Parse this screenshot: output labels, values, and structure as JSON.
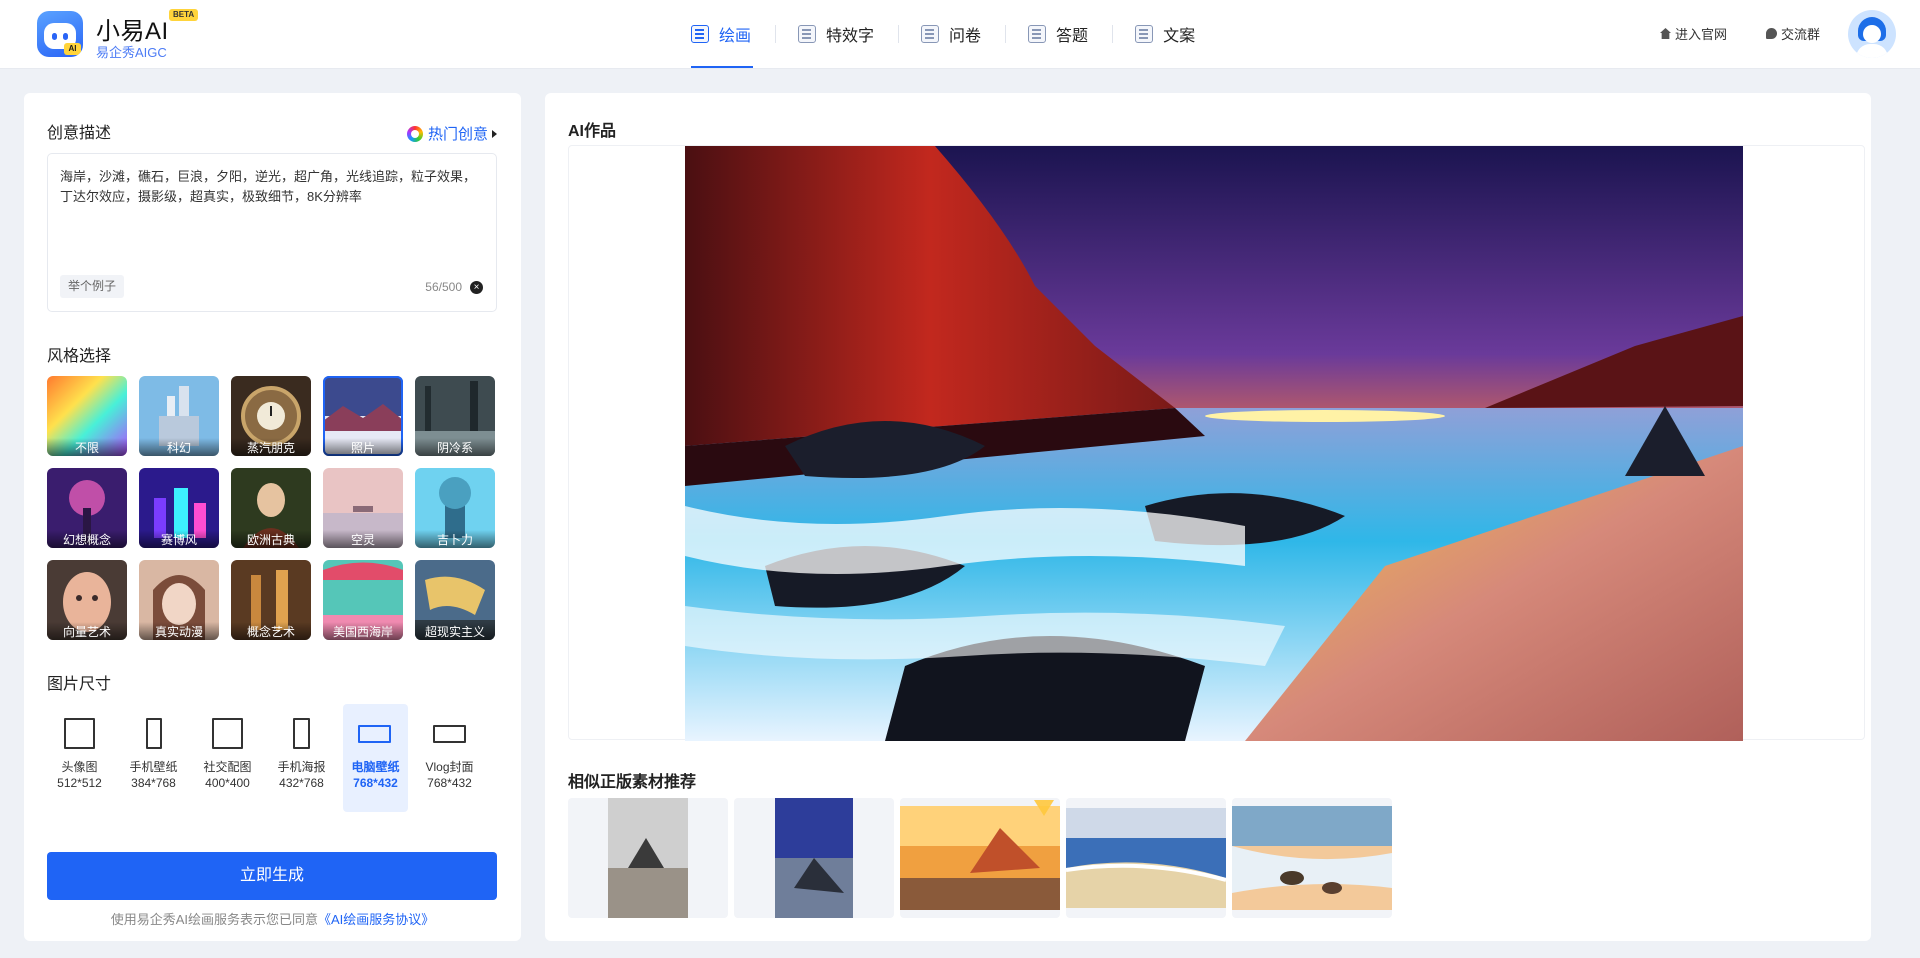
{
  "header": {
    "brand_name": "小易AI",
    "beta": "BETA",
    "brand_sub": "易企秀AIGC",
    "logo_tag": "AI",
    "nav": [
      {
        "label": "绘画",
        "icon": "paint-icon",
        "active": true
      },
      {
        "label": "特效字",
        "icon": "effect-text-icon",
        "active": false
      },
      {
        "label": "问卷",
        "icon": "survey-icon",
        "active": false
      },
      {
        "label": "答题",
        "icon": "quiz-icon",
        "active": false
      },
      {
        "label": "文案",
        "icon": "copywriting-icon",
        "active": false
      }
    ],
    "official_site": "进入官网",
    "community": "交流群"
  },
  "left": {
    "prompt_title": "创意描述",
    "hot_ideas": "热门创意",
    "prompt_text": "海岸，沙滩，礁石，巨浪，夕阳，逆光，超广角，光线追踪，粒子效果，丁达尔效应，摄影级，超真实，极致细节，8K分辨率",
    "example_button": "举个例子",
    "counter": "56/500",
    "style_title": "风格选择",
    "styles": [
      {
        "label": "不限",
        "selected": false
      },
      {
        "label": "科幻",
        "selected": false
      },
      {
        "label": "蒸汽朋克",
        "selected": false
      },
      {
        "label": "照片",
        "selected": true
      },
      {
        "label": "阴冷系",
        "selected": false
      },
      {
        "label": "幻想概念",
        "selected": false
      },
      {
        "label": "赛博风",
        "selected": false
      },
      {
        "label": "欧洲古典",
        "selected": false
      },
      {
        "label": "空灵",
        "selected": false
      },
      {
        "label": "吉卜力",
        "selected": false
      },
      {
        "label": "向量艺术",
        "selected": false
      },
      {
        "label": "真实动漫",
        "selected": false
      },
      {
        "label": "概念艺术",
        "selected": false
      },
      {
        "label": "美国西海岸",
        "selected": false
      },
      {
        "label": "超现实主义",
        "selected": false
      }
    ],
    "size_title": "图片尺寸",
    "sizes": [
      {
        "name": "头像图",
        "dim": "512*512",
        "active": false
      },
      {
        "name": "手机壁纸",
        "dim": "384*768",
        "active": false
      },
      {
        "name": "社交配图",
        "dim": "400*400",
        "active": false
      },
      {
        "name": "手机海报",
        "dim": "432*768",
        "active": false
      },
      {
        "name": "电脑壁纸",
        "dim": "768*432",
        "active": true
      },
      {
        "name": "Vlog封面",
        "dim": "768*432",
        "active": false
      }
    ],
    "generate": "立即生成",
    "agreement_prefix": "使用易企秀AI绘画服务表示您已同意",
    "agreement_link": "《AI绘画服务协议》"
  },
  "right": {
    "title": "AI作品",
    "recommend_title": "相似正版素材推荐"
  },
  "colors": {
    "accent": "#1f64f5",
    "background": "#eef1f6"
  }
}
